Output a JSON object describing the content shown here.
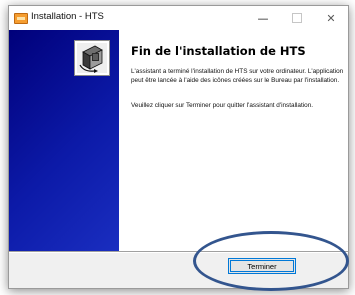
{
  "window": {
    "title": "Installation - HTS",
    "app_icon": "installer-app-icon",
    "controls": {
      "minimize_icon": "minimize-icon",
      "maximize_icon": "maximize-icon",
      "close_icon": "close-icon",
      "close_glyph": "✕",
      "minimize_glyph": "—"
    }
  },
  "side_panel": {
    "icon": "installer-computer-icon",
    "background_color": "#0c1aa8"
  },
  "content": {
    "heading": "Fin de l'installation de HTS",
    "paragraph_1": "L'assistant a terminé l'installation de HTS sur votre ordinateur. L'application peut être lancée à l'aide des icônes créées sur le Bureau par l'installation.",
    "paragraph_2": "Veuillez cliquer sur Terminer pour quitter l'assistant d'installation."
  },
  "footer": {
    "finish_label": "Terminer"
  },
  "annotation": {
    "shape": "ellipse",
    "color": "#33558e"
  }
}
